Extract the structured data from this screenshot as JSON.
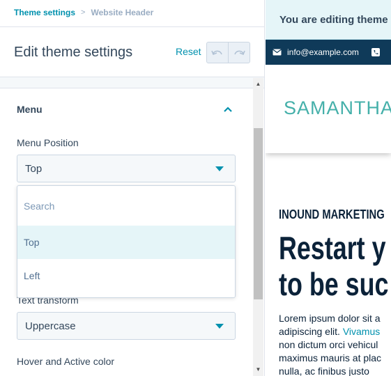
{
  "breadcrumb": {
    "parent": "Theme settings",
    "separator": ">",
    "current": "Website Header"
  },
  "panel": {
    "title": "Edit theme settings",
    "reset_label": "Reset"
  },
  "menu_section": {
    "title": "Menu",
    "menu_position": {
      "label": "Menu Position",
      "value": "Top"
    },
    "dropdown": {
      "search_placeholder": "Search",
      "options": [
        "Top",
        "Left"
      ],
      "selected": "Top"
    },
    "text_transform": {
      "label": "Text transform",
      "value": "Uppercase"
    },
    "hover_color_label": "Hover and Active color"
  },
  "preview": {
    "banner": "You are editing theme settings",
    "email": "info@example.com",
    "logo": "SAMANTHA",
    "kicker": "INOUND MARKETING",
    "headline_lines": [
      "Restart y",
      "to be suc"
    ],
    "body_lines": [
      "Lorem ipsum dolor sit a",
      "adipiscing elit.",
      "Vivamus",
      "non dictum orci vehicul",
      "maximus mauris at plac",
      "nulla, ac finibus justo"
    ]
  },
  "colors": {
    "accent": "#0091ae",
    "text": "#33475b",
    "contact_bar": "#0f3a59",
    "logo": "#45b0aa",
    "selected_option_bg": "#e5f5f8"
  },
  "icons": {
    "breadcrumb_separator": "chevron-right-icon",
    "undo": "undo-icon",
    "redo": "redo-icon",
    "section_toggle": "chevron-up-icon",
    "select_caret": "caret-down-icon",
    "email": "envelope-icon",
    "phone": "phone-icon"
  }
}
